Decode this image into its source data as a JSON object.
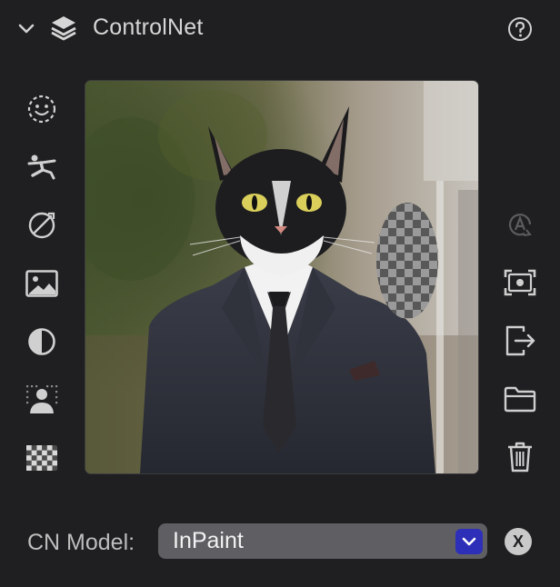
{
  "panel": {
    "title": "ControlNet",
    "collapse_icon": "chevron-down-icon",
    "section_icon": "layers-icon",
    "help_icon": "question-circle-icon"
  },
  "left_tools": [
    {
      "name": "face-detect-icon"
    },
    {
      "name": "pose-icon"
    },
    {
      "name": "edge-detect-icon"
    },
    {
      "name": "image-icon"
    },
    {
      "name": "contrast-icon"
    },
    {
      "name": "person-segment-icon"
    },
    {
      "name": "checkerboard-icon"
    }
  ],
  "right_tools": [
    {
      "name": "auto-annotate-icon",
      "enabled": false
    },
    {
      "name": "capture-canvas-icon",
      "enabled": true
    },
    {
      "name": "export-icon",
      "enabled": true
    },
    {
      "name": "folder-icon",
      "enabled": true
    },
    {
      "name": "trash-icon",
      "enabled": true
    }
  ],
  "canvas": {
    "subject": "cat-in-suit",
    "mask": "transparent-inpaint-region"
  },
  "model": {
    "label": "CN Model:",
    "value": "InPaint",
    "clear_label": "X"
  },
  "colors": {
    "background": "#1f1f21",
    "accent": "#2e2fb8",
    "select_bg": "#5f5f63"
  }
}
